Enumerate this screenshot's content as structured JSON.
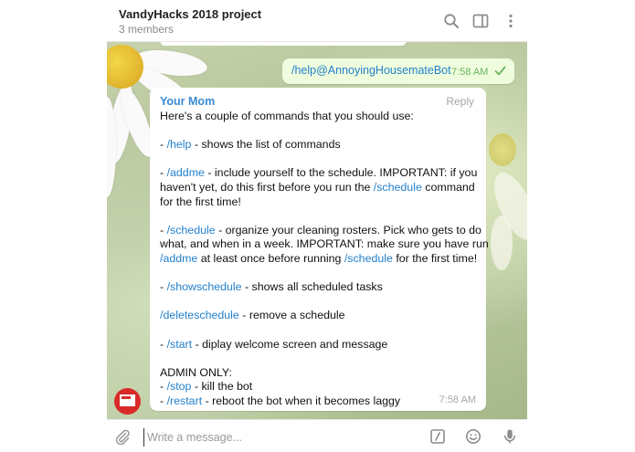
{
  "header": {
    "title": "VandyHacks 2018 project",
    "members": "3 members"
  },
  "icons": {
    "search": "search-icon",
    "sidebar": "sidebar-toggle-icon",
    "more": "more-vertical-icon",
    "attach": "paperclip-icon",
    "commands": "bot-command-icon",
    "emoji": "emoji-icon",
    "mic": "microphone-icon"
  },
  "outgoing": {
    "text": "/help@AnnoyingHousemateBot",
    "time": "7:58 AM"
  },
  "incoming": {
    "sender": "Your Mom",
    "reply_label": "Reply",
    "time": "7:58 AM",
    "intro": "Here's a couple of commands that you should use:",
    "help_cmd": "/help",
    "help_desc": " - shows the list of commands",
    "addme_cmd": "/addme",
    "addme_desc_1": " - include yourself to the schedule. IMPORTANT: if you",
    "addme_desc_2a": "haven't yet, do this first before you run the ",
    "addme_desc_2_cmd": "/schedule",
    "addme_desc_2b": " command",
    "addme_desc_3": "for the first time!",
    "schedule_cmd": "/schedule",
    "schedule_desc_1": " - organize your cleaning rosters. Pick who gets to do",
    "schedule_desc_2": "what, and when in a week. IMPORTANT: make sure you have run",
    "schedule_desc_3_cmd": "/addme",
    "schedule_desc_3a": " at least once before running ",
    "schedule_desc_3_cmd2": "/schedule",
    "schedule_desc_3b": " for the first time!",
    "showschedule_cmd": "/showschedule",
    "showschedule_desc": " - shows all scheduled tasks",
    "deleteschedule_cmd": "/deleteschedule",
    "deleteschedule_desc": " - remove a schedule",
    "start_cmd": "/start",
    "start_desc": " - diplay welcome screen and message",
    "admin_label": "ADMIN ONLY:",
    "stop_cmd": "/stop",
    "stop_desc": " - kill the bot",
    "restart_cmd": "/restart",
    "restart_desc": " - reboot the bot when it becomes laggy"
  },
  "composer": {
    "placeholder": "Write a message..."
  },
  "colors": {
    "link": "#2481cc",
    "sender": "#3a8bd1",
    "outgoing_bg": "#effdde",
    "check": "#6cb360"
  }
}
